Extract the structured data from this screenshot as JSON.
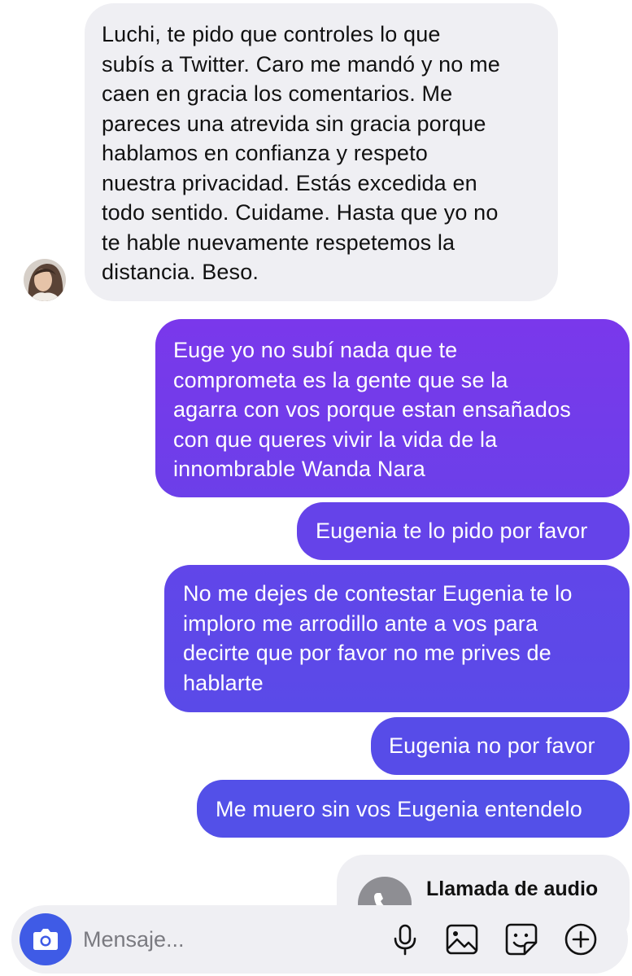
{
  "messages": [
    {
      "direction": "incoming",
      "text": "Luchi, te pido que controles lo que\nsubís a Twitter. Caro me mandó y no me\ncaen en gracia los comentarios. Me\npareces una atrevida sin gracia porque\nhablamos en confianza y respeto\nnuestra privacidad. Estás excedida en\ntodo sentido. Cuidame. Hasta que yo no\nte hable nuevamente respetemos la\ndistancia. Beso."
    },
    {
      "direction": "outgoing",
      "text": "Euge yo no subí nada que te\ncomprometa es la gente que se la\nagarra con vos porque estan ensañados\ncon que queres vivir la vida de la\ninnombrable Wanda Nara"
    },
    {
      "direction": "outgoing",
      "text": "Eugenia te lo pido por favor"
    },
    {
      "direction": "outgoing",
      "text": "No me dejes de contestar Eugenia te lo\nimploro me arrodillo ante a vos para\ndecirte que por favor no me prives de\nhablarte"
    },
    {
      "direction": "outgoing",
      "text": "Eugenia no por favor"
    },
    {
      "direction": "outgoing",
      "text": "Me muero sin vos Eugenia entendelo"
    }
  ],
  "call": {
    "title": "Llamada de audio",
    "icon": "phone-icon"
  },
  "composer": {
    "placeholder": "Mensaje...",
    "value": "",
    "icons": [
      "camera-icon",
      "microphone-icon",
      "gallery-icon",
      "sticker-icon",
      "plus-icon"
    ]
  },
  "colors": {
    "incoming_bubble": "#efeff3",
    "outgoing_top": "#7a38eb",
    "outgoing_bottom": "#5050e8",
    "camera_button": "#3f5be6"
  }
}
